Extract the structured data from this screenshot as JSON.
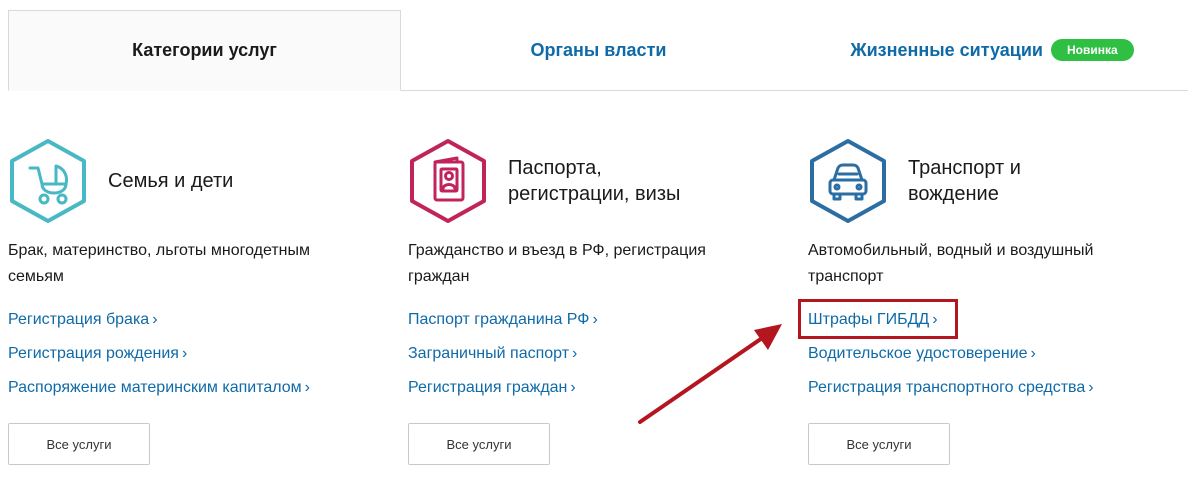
{
  "tabs": [
    {
      "label": "Категории услуг"
    },
    {
      "label": "Органы власти"
    },
    {
      "label": "Жизненные ситуации",
      "badge": "Новинка"
    }
  ],
  "categories": [
    {
      "icon": "baby-stroller-icon",
      "title": "Семья и дети",
      "description": "Брак, материнство, льготы многодетным семьям",
      "links": [
        {
          "label": "Регистрация брака"
        },
        {
          "label": "Регистрация рождения"
        },
        {
          "label": "Распоряжение материнским капиталом"
        }
      ],
      "button": "Все услуги",
      "color": "#47b8c4"
    },
    {
      "icon": "passport-icon",
      "title": "Паспорта,\nрегистрации, визы",
      "description": "Гражданство и въезд в РФ, регистрация граждан",
      "links": [
        {
          "label": "Паспорт гражданина РФ"
        },
        {
          "label": "Заграничный паспорт"
        },
        {
          "label": "Регистрация граждан"
        }
      ],
      "button": "Все услуги",
      "color": "#c0245a"
    },
    {
      "icon": "car-icon",
      "title": "Транспорт и\nвождение",
      "description": "Автомобильный, водный и воздушный транспорт",
      "links": [
        {
          "label": "Штрафы ГИБДД"
        },
        {
          "label": "Водительское удостоверение"
        },
        {
          "label": "Регистрация транспортного средства"
        }
      ],
      "button": "Все услуги",
      "color": "#2a6ea3"
    }
  ],
  "chevron": "›",
  "colors": {
    "link": "#0f6aa8",
    "badge": "#2fc043",
    "annotation": "#b3161f"
  }
}
